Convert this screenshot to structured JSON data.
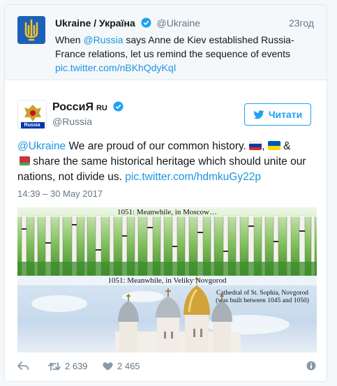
{
  "parent_tweet": {
    "name": "Ukraine / Україна",
    "handle": "@Ukraine",
    "time": "23год",
    "text_parts": {
      "t1": "When ",
      "mention": "@Russia",
      "t2": " says Anne de Kiev established Russia-France relations, let us remind the sequence of events",
      "link": "pic.twitter.com/nBKhQdyKqI"
    },
    "avatar_icon": "trident-coat-of-arms-icon"
  },
  "main_tweet": {
    "name": "РоссиЯ",
    "country_code": "RU",
    "handle": "@Russia",
    "follow_label": "Читати",
    "avatar_label": "Russia",
    "text": {
      "mention": "@Ukraine",
      "t1": " We are proud of our common history.",
      "amp": "&",
      "t2": " share the same historical heritage which should unite our nations, not divide us. ",
      "link": "pic.twitter.com/hdmkuGy22p"
    },
    "timestamp": "14:39 – 30 May 2017"
  },
  "media": {
    "caption_top": "1051: Meanwhile, in Moscow…",
    "caption_mid": "1051: Meanwhile, in Veliky Novgorod",
    "cathedral_line1": "Cathedral of St. Sophia, Novgorod",
    "cathedral_line2": "(was built between 1045 and 1050)"
  },
  "actions": {
    "retweets": "2 639",
    "likes": "2 465"
  },
  "colors": {
    "link": "#1b95e0",
    "verified": "#1da1f2",
    "muted": "#657786"
  }
}
